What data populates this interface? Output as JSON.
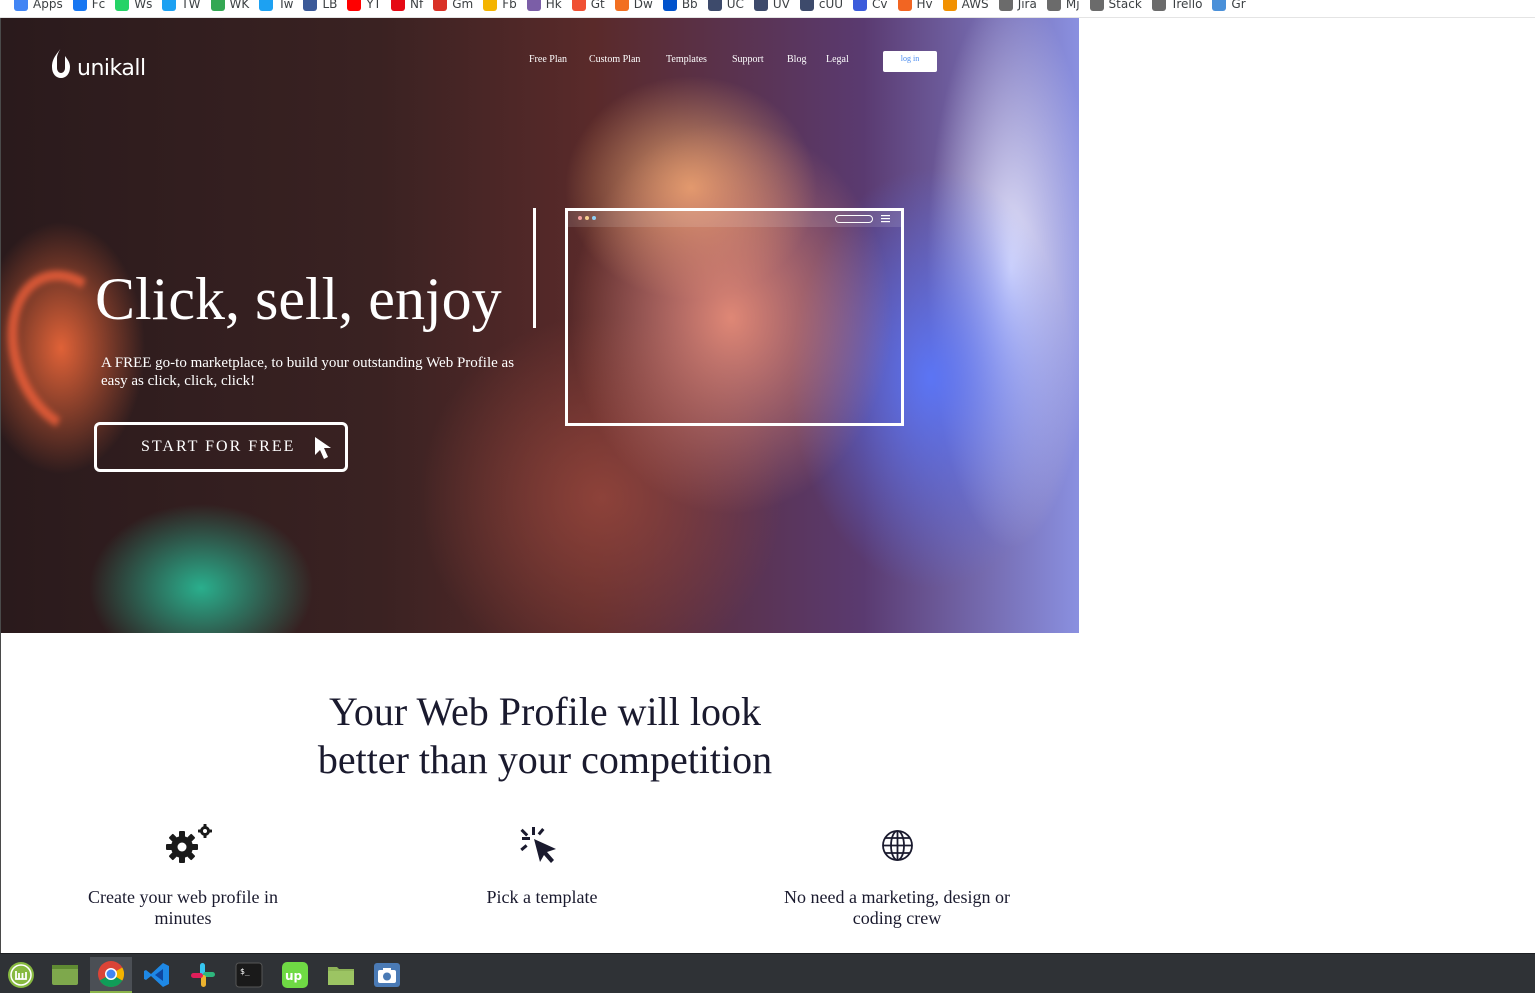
{
  "bookmarks": [
    {
      "label": "Apps",
      "color": "#4285f4"
    },
    {
      "label": "Fc",
      "color": "#1877f2"
    },
    {
      "label": "Ws",
      "color": "#25d366"
    },
    {
      "label": "TW",
      "color": "#1da1f2"
    },
    {
      "label": "WK",
      "color": "#34a853"
    },
    {
      "label": "Tw",
      "color": "#1da1f2"
    },
    {
      "label": "LB",
      "color": "#3b5998"
    },
    {
      "label": "YT",
      "color": "#ff0000"
    },
    {
      "label": "Nf",
      "color": "#e50914"
    },
    {
      "label": "Gm",
      "color": "#d93025"
    },
    {
      "label": "Fb",
      "color": "#f4b400"
    },
    {
      "label": "Hk",
      "color": "#7b5ea7"
    },
    {
      "label": "Gt",
      "color": "#f05033"
    },
    {
      "label": "Dw",
      "color": "#f26f21"
    },
    {
      "label": "Bb",
      "color": "#0052cc"
    },
    {
      "label": "UC",
      "color": "#3d4a6b"
    },
    {
      "label": "UV",
      "color": "#3d4a6b"
    },
    {
      "label": "cUU",
      "color": "#3d4a6b"
    },
    {
      "label": "Cv",
      "color": "#3b5bdb"
    },
    {
      "label": "Hv",
      "color": "#f26522"
    },
    {
      "label": "AWS",
      "color": "#f29100"
    },
    {
      "label": "Jira",
      "color": "#6b6b6b"
    },
    {
      "label": "Mj",
      "color": "#6b6b6b"
    },
    {
      "label": "Stack",
      "color": "#6b6b6b"
    },
    {
      "label": "Trello",
      "color": "#6b6b6b"
    },
    {
      "label": "Gr",
      "color": "#4a90d9"
    }
  ],
  "brand": {
    "name": "unikall"
  },
  "nav": {
    "links": [
      "Free Plan",
      "Custom Plan",
      "Templates",
      "Support",
      "Blog",
      "Legal"
    ],
    "login_label": "log in"
  },
  "hero": {
    "title": "Click, sell, enjoy",
    "subtitle": "A FREE go-to marketplace, to build your outstanding Web Profile as easy as click, click, click!",
    "cta_label": "START FOR FREE"
  },
  "features": {
    "title": "Your Web Profile will look better than your competition",
    "items": [
      {
        "label": "Create your web profile in minutes",
        "icon": "gears-icon"
      },
      {
        "label": "Pick a template",
        "icon": "click-cursor-icon"
      },
      {
        "label": "No need a marketing, design or coding crew",
        "icon": "globe-icon"
      }
    ]
  },
  "taskbar": {
    "apps": [
      {
        "name": "mint-menu-icon",
        "color": "#87b940"
      },
      {
        "name": "files-icon",
        "color": "#7ea84c"
      },
      {
        "name": "chrome-icon",
        "color": "#4285f4"
      },
      {
        "name": "vscode-icon",
        "color": "#1e88e5"
      },
      {
        "name": "slack-icon",
        "color": "#e8e8e8"
      },
      {
        "name": "terminal-icon",
        "color": "#1a1a1a"
      },
      {
        "name": "upwork-icon",
        "color": "#6fda44"
      },
      {
        "name": "folder-icon",
        "color": "#8db357"
      },
      {
        "name": "screenshot-icon",
        "color": "#4a7ab5"
      }
    ]
  }
}
